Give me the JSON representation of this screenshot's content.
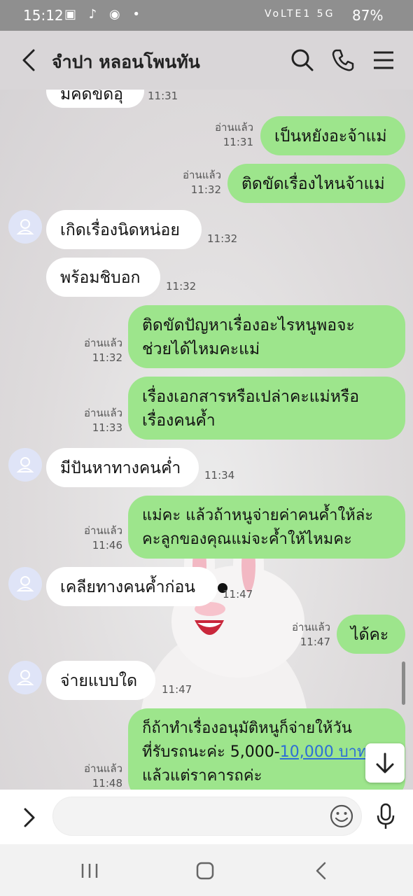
{
  "status_bar": {
    "time": "15:12",
    "left_icons": "▣ ♪ ◉ •",
    "network": "VoLTE1 5G",
    "battery": "87%"
  },
  "header": {
    "title": "จำปา หลอนโพนทัน",
    "icons": [
      "back-icon",
      "search-icon",
      "phone-icon",
      "menu-icon"
    ]
  },
  "messages": [
    {
      "side": "in",
      "text": "มีคิดขัดอุ",
      "time": "11:31"
    },
    {
      "side": "out",
      "text": "เป็นหยังอะจ้าแม่",
      "read": "อ่านแล้ว",
      "time": "11:31"
    },
    {
      "side": "out",
      "text": "ติดขัดเรื่องไหนจ้าแม่",
      "read": "อ่านแล้ว",
      "time": "11:32"
    },
    {
      "side": "in",
      "text": "เกิดเรื่องนิดหน่อย",
      "time": "11:32"
    },
    {
      "side": "in",
      "text": "พร้อมชิบอก",
      "time": "11:32"
    },
    {
      "side": "out",
      "line1": "ติดขัดปัญหาเรื่องอะไรหนูพอจะ",
      "line2": "ช่วยได้ไหมคะแม่",
      "read": "อ่านแล้ว",
      "time": "11:32"
    },
    {
      "side": "out",
      "line1": "เรื่องเอกสารหรือเปล่าคะแม่หรือ",
      "line2": "เรื่องคนค้ำ",
      "read": "อ่านแล้ว",
      "time": "11:33"
    },
    {
      "side": "in",
      "text": "มีปันหาทางคนค่ำ",
      "time": "11:34"
    },
    {
      "side": "out",
      "line1": "แม่คะ แล้วถ้าหนูจ่ายค่าคนค้ำให้ล่ะ",
      "line2": "คะลูกของคุณแม่จะค้ำให้ไหมคะ",
      "read": "อ่านแล้ว",
      "time": "11:46"
    },
    {
      "side": "in",
      "text": "เคลียทางคนค้ำก่อน",
      "time": "11:47"
    },
    {
      "side": "out",
      "text": "ได้คะ",
      "read": "อ่านแล้ว",
      "time": "11:47"
    },
    {
      "side": "in",
      "text": "จ่ายแบบใด",
      "time": "11:47"
    },
    {
      "side": "out",
      "line1": "ก็ถ้าทำเรื่องอนุมัติหนูก็จ่ายให้วัน",
      "line2_pre": "ที่รับรถนะค่ะ 5,000-",
      "line2_link": "10,000 บาท",
      "line3": "แล้วแต่ราคารถค่ะ",
      "read": "อ่านแล้ว",
      "time": "11:48"
    }
  ],
  "colors": {
    "outgoing": "#9de58c",
    "incoming": "#ffffff",
    "link": "#2d6fd6"
  }
}
